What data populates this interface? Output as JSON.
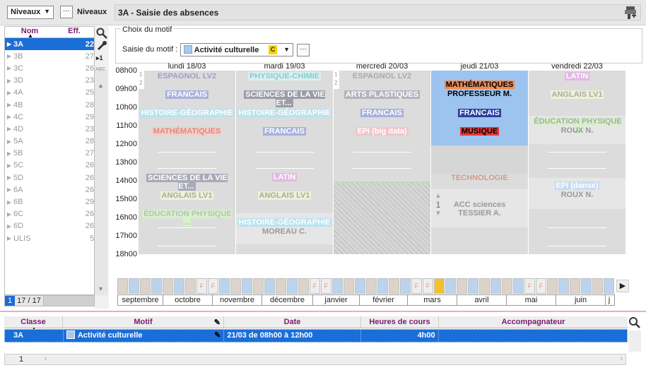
{
  "toolbar": {
    "select_value": "Niveaux",
    "more_label": "···",
    "title_label": "Niveaux"
  },
  "page": {
    "title": "3A - Saisie des absences"
  },
  "list": {
    "col_name": "Nom",
    "col_eff": "Eff.",
    "rows": [
      {
        "name": "3A",
        "eff": "22"
      },
      {
        "name": "3B",
        "eff": "27"
      },
      {
        "name": "3C",
        "eff": "26"
      },
      {
        "name": "3D",
        "eff": "23"
      },
      {
        "name": "4A",
        "eff": "25"
      },
      {
        "name": "4B",
        "eff": "28"
      },
      {
        "name": "4C",
        "eff": "29"
      },
      {
        "name": "4D",
        "eff": "23"
      },
      {
        "name": "5A",
        "eff": "28"
      },
      {
        "name": "5B",
        "eff": "27"
      },
      {
        "name": "5C",
        "eff": "26"
      },
      {
        "name": "5D",
        "eff": "26"
      },
      {
        "name": "6A",
        "eff": "26"
      },
      {
        "name": "6B",
        "eff": "29"
      },
      {
        "name": "6C",
        "eff": "26"
      },
      {
        "name": "6D",
        "eff": "26"
      },
      {
        "name": "ULIS",
        "eff": "5"
      }
    ],
    "page_num": "1",
    "page_count": "17 / 17"
  },
  "motif": {
    "legend": "Choix du motif",
    "label": "Saisie du motif :",
    "value": "Activité culturelle",
    "badge": "C",
    "more": "···"
  },
  "days": [
    "lundi 18/03",
    "mardi 19/03",
    "mercredi 20/03",
    "jeudi 21/03",
    "vendredi 22/03"
  ],
  "hours": [
    "08h00",
    "09h00",
    "10h00",
    "11h00",
    "12h00",
    "13h00",
    "14h00",
    "15h00",
    "16h00",
    "17h00",
    "18h00"
  ],
  "lessons": {
    "mon": [
      "ESPAGNOL LV2",
      "FRANCAIS",
      "HISTOIRE-GÉOGRAPHIE",
      "MATHÉMATIQUES",
      "SCIENCES DE LA VIE ET...",
      "ANGLAIS LV1",
      "ÉDUCATION PHYSIQUE ..."
    ],
    "tue": [
      "PHYSIQUE-CHIMIE",
      "SCIENCES DE LA VIE ET...",
      "HISTOIRE-GÉOGRAPHIE",
      "FRANCAIS",
      "LATIN",
      "ANGLAIS LV1",
      "HISTOIRE-GÉOGRAPHIE",
      "MOREAU C."
    ],
    "wed": [
      "ESPAGNOL LV2",
      "ARTS PLASTIQUES",
      "FRANCAIS",
      "EPI (big data)"
    ],
    "thu": [
      "MATHÉMATIQUES",
      "PROFESSEUR M.",
      "FRANCAIS",
      "MUSIQUE",
      "TECHNOLOGIE",
      "1",
      "ACC sciences",
      "TESSIER A."
    ],
    "fri": [
      "LATIN",
      "ANGLAIS LV1",
      "ÉDUCATION PHYSIQUE ...",
      "ROUX N.",
      "EPI (danse)",
      "ROUX N."
    ]
  },
  "timeline": {
    "months": [
      "septembre",
      "octobre",
      "novembre",
      "décembre",
      "janvier",
      "février",
      "mars",
      "avril",
      "mai",
      "juin",
      "j"
    ],
    "holiday_mark": "F"
  },
  "table": {
    "headers": [
      "Classe",
      "Motif",
      "Date",
      "Heures de cours",
      "Accompagnateur"
    ],
    "row": {
      "classe": "3A",
      "motif": "Activité culturelle",
      "date": "21/03 de 08h00 à 12h00",
      "heures": "4h00",
      "acc": ""
    },
    "page_num": "1"
  },
  "colors": {
    "selection": "#1a6ed8",
    "header_text": "#7a1b6e",
    "motif_badge": "#f5d400",
    "current_day": "#9dc3ef"
  }
}
